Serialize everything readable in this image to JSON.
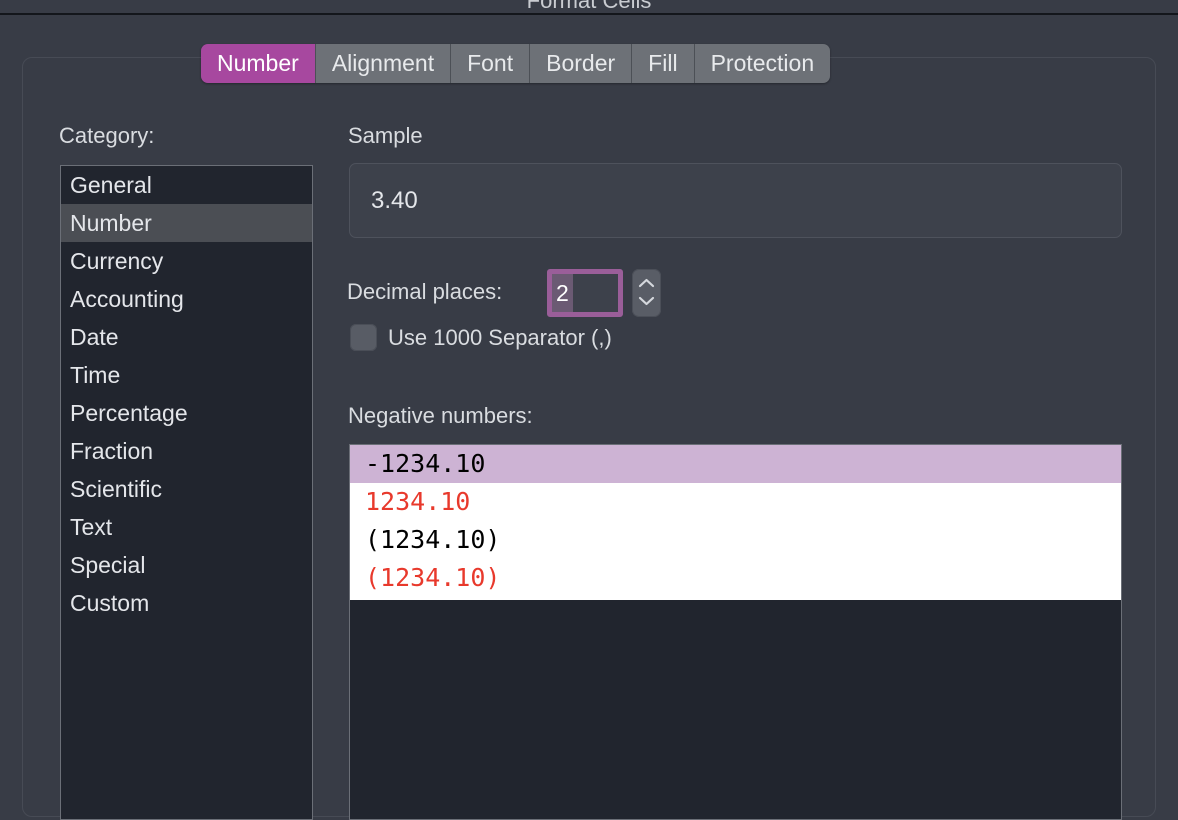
{
  "window": {
    "title": "Format Cells"
  },
  "tabs": [
    {
      "label": "Number",
      "active": true
    },
    {
      "label": "Alignment",
      "active": false
    },
    {
      "label": "Font",
      "active": false
    },
    {
      "label": "Border",
      "active": false
    },
    {
      "label": "Fill",
      "active": false
    },
    {
      "label": "Protection",
      "active": false
    }
  ],
  "category": {
    "label": "Category:",
    "selected": "Number",
    "items": [
      "General",
      "Number",
      "Currency",
      "Accounting",
      "Date",
      "Time",
      "Percentage",
      "Fraction",
      "Scientific",
      "Text",
      "Special",
      "Custom"
    ]
  },
  "sample": {
    "label": "Sample",
    "value": "3.40"
  },
  "decimal_places": {
    "label": "Decimal places:",
    "value": "2",
    "stepper_up": "chevron-up-icon",
    "stepper_down": "chevron-down-icon"
  },
  "thousands_separator": {
    "label": "Use 1000 Separator (,)",
    "checked": false
  },
  "negative_numbers": {
    "label": "Negative numbers:",
    "selected_index": 0,
    "items": [
      {
        "text": "-1234.10",
        "color": "black",
        "selected": true
      },
      {
        "text": "1234.10",
        "color": "red",
        "selected": false
      },
      {
        "text": "(1234.10)",
        "color": "black",
        "selected": false
      },
      {
        "text": "(1234.10)",
        "color": "red",
        "selected": false
      }
    ]
  },
  "colors": {
    "accent": "#a7489f",
    "selection_purple": "#cdb3d4",
    "negative_red": "#e8392c",
    "dialog_bg": "#383c46",
    "list_bg": "#21252e"
  }
}
